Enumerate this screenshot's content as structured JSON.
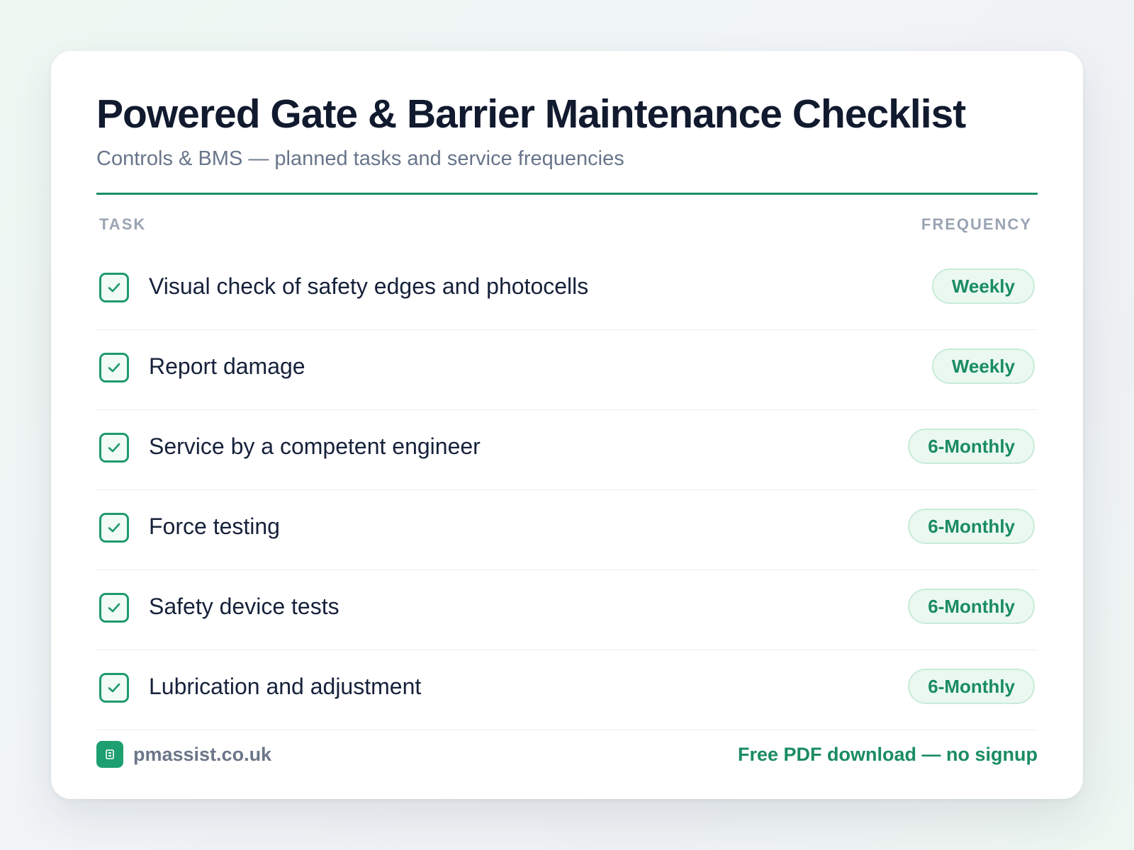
{
  "header": {
    "title": "Powered Gate & Barrier Maintenance Checklist",
    "subtitle": "Controls & BMS — planned tasks and service frequencies"
  },
  "columns": {
    "task": "TASK",
    "frequency": "FREQUENCY"
  },
  "tasks": [
    {
      "label": "Visual check of safety edges and photocells",
      "frequency": "Weekly",
      "checked": true
    },
    {
      "label": "Report damage",
      "frequency": "Weekly",
      "checked": true
    },
    {
      "label": "Service by a competent engineer",
      "frequency": "6-Monthly",
      "checked": true
    },
    {
      "label": "Force testing",
      "frequency": "6-Monthly",
      "checked": true
    },
    {
      "label": "Safety device tests",
      "frequency": "6-Monthly",
      "checked": true
    },
    {
      "label": "Lubrication and adjustment",
      "frequency": "6-Monthly",
      "checked": true
    }
  ],
  "footer": {
    "logo_icon": "building-icon",
    "site": "pmassist.co.uk",
    "cta": "Free PDF download — no signup"
  },
  "colors": {
    "accent": "#1b8f66",
    "title": "#111a2e",
    "muted": "#68758a",
    "badge_bg": "#eaf8f0"
  }
}
